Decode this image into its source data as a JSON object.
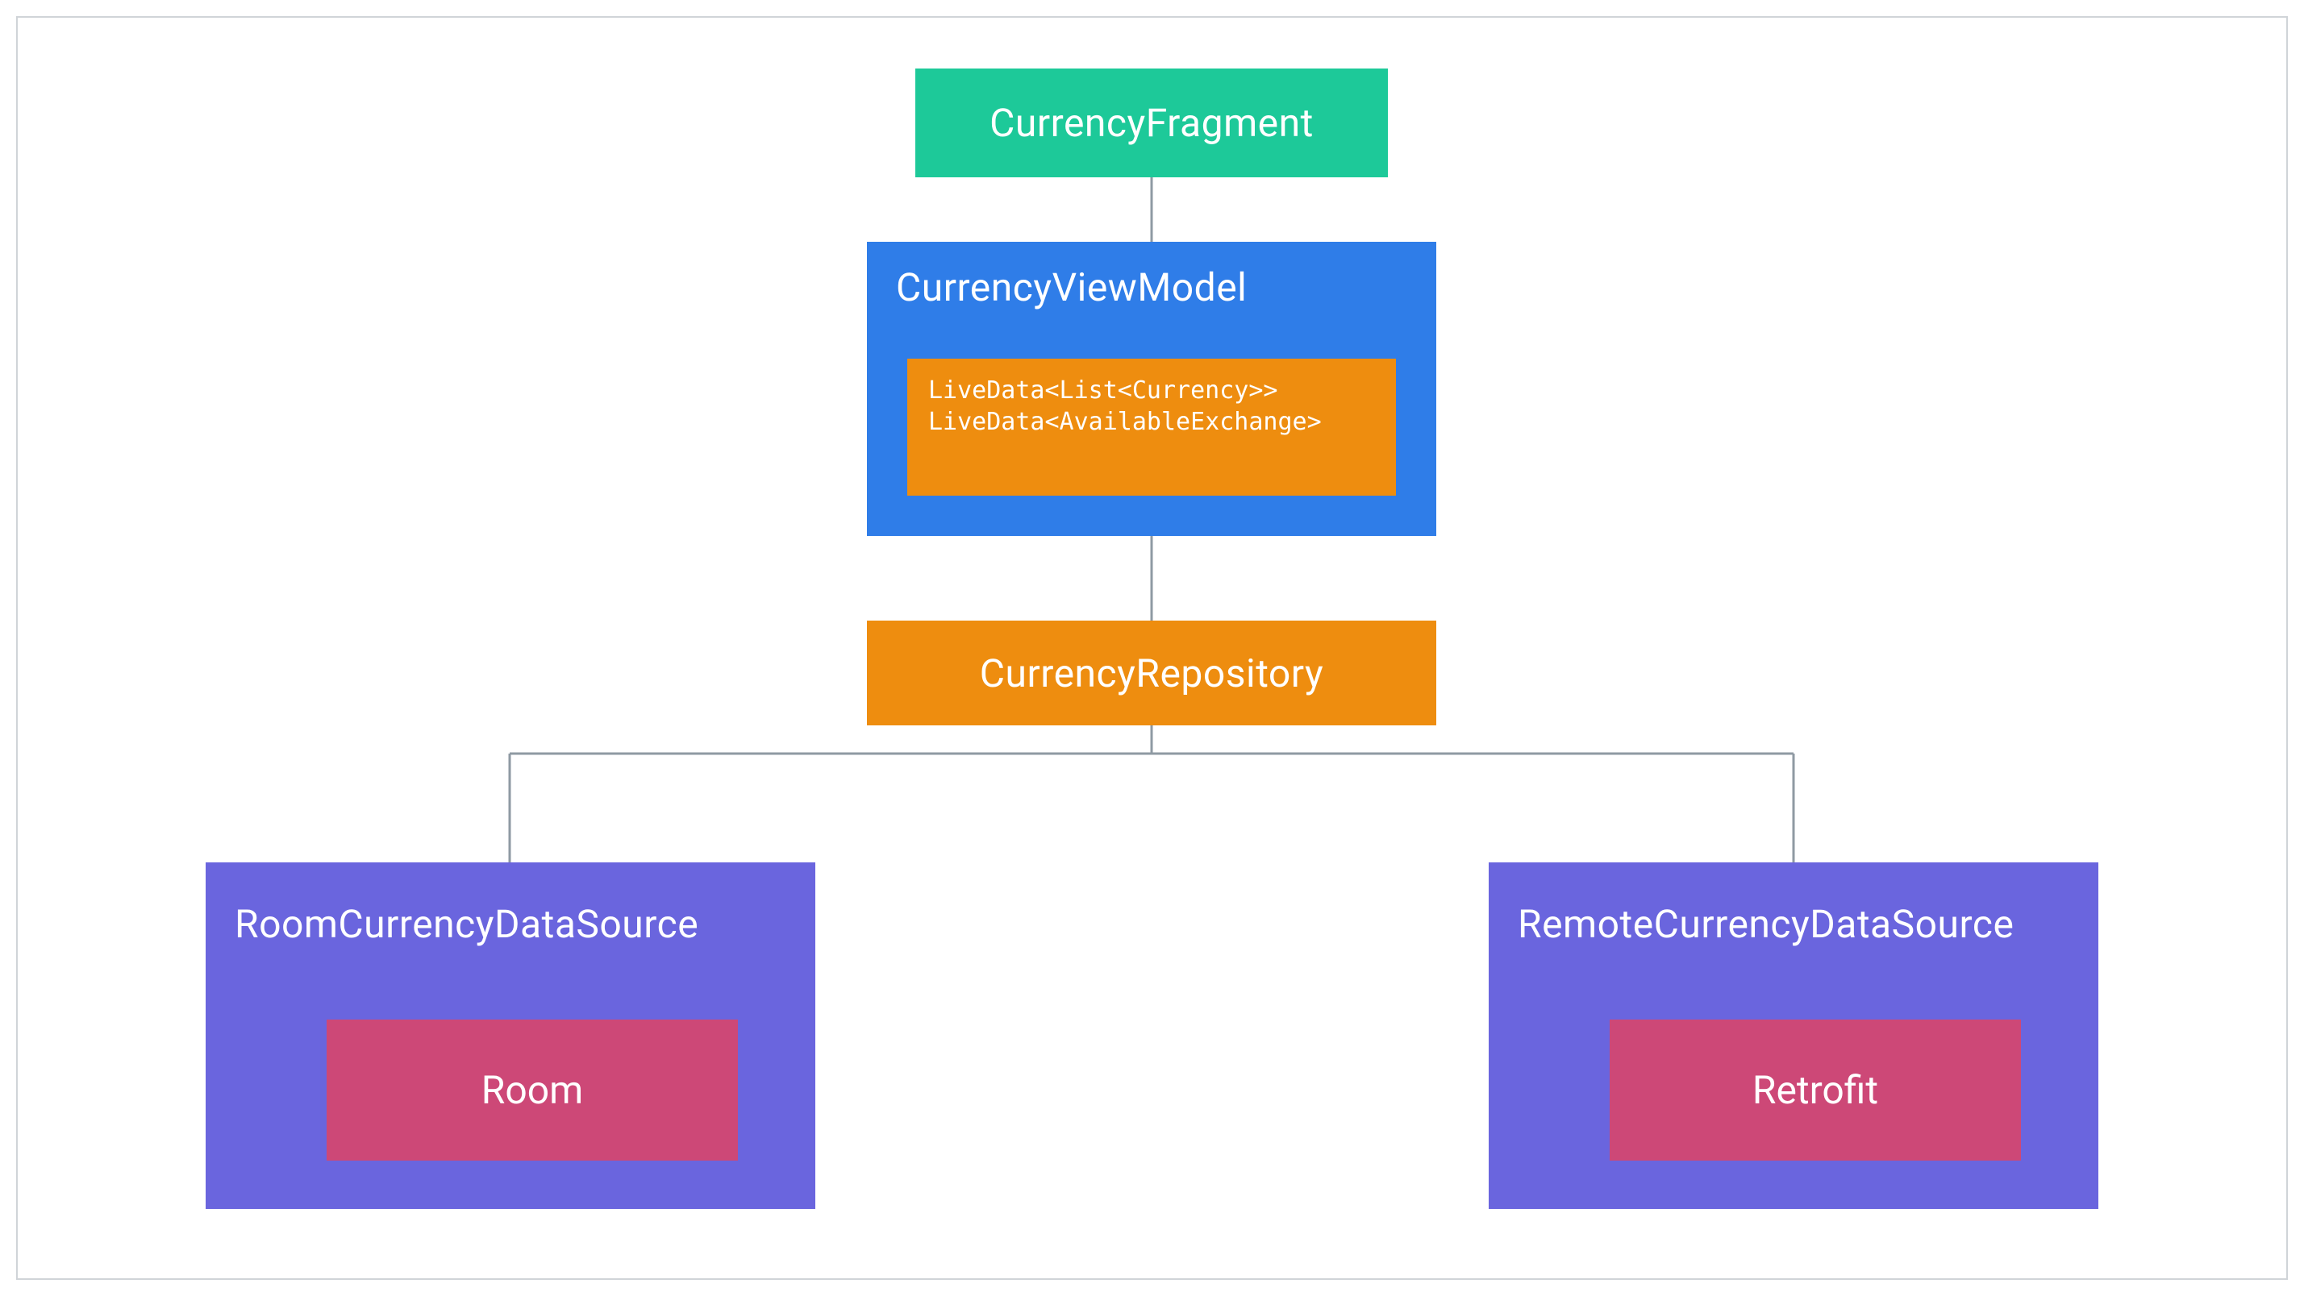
{
  "colors": {
    "teal": "#1dc999",
    "blue": "#2f7de8",
    "orange": "#ee8d0f",
    "purple": "#6a65de",
    "pink": "#cd4877",
    "border": "#d0d4d8",
    "line": "#8f9aa3"
  },
  "nodes": {
    "fragment": {
      "label": "CurrencyFragment"
    },
    "viewmodel": {
      "label": "CurrencyViewModel",
      "code": "LiveData<List<Currency>>\nLiveData<AvailableExchange>"
    },
    "repository": {
      "label": "CurrencyRepository"
    },
    "roomDs": {
      "label": "RoomCurrencyDataSource",
      "inner": "Room"
    },
    "remoteDs": {
      "label": "RemoteCurrencyDataSource",
      "inner": "Retrofit"
    }
  }
}
